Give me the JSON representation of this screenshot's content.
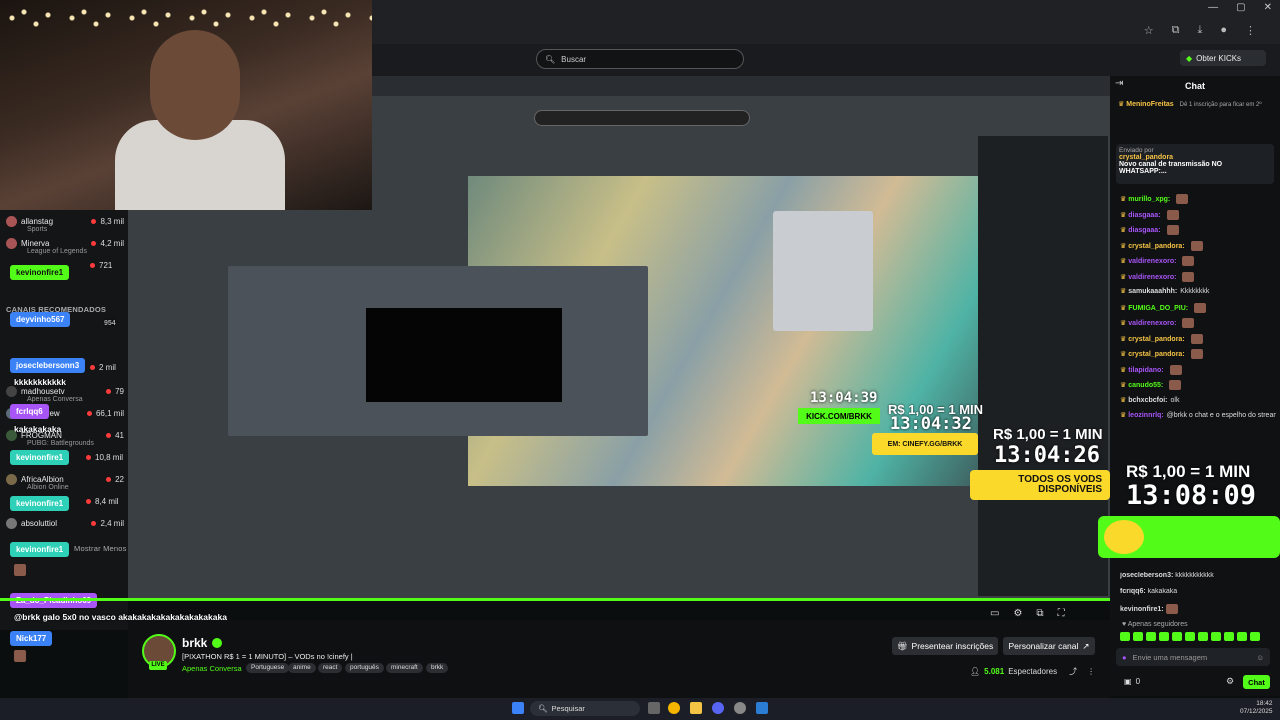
{
  "browser": {
    "window_controls": [
      "—",
      "▢",
      "✕"
    ]
  },
  "header": {
    "search_placeholder": "Buscar",
    "kicks_label": "Obter KICKs"
  },
  "sidebar": {
    "items": [
      {
        "name": "allanstag",
        "sub": "Sports",
        "count": "8,3 mil"
      },
      {
        "name": "Minerva",
        "sub": "League of Legends",
        "count": "4,2 mil"
      },
      {
        "name": "kevinonfire1",
        "sub": "",
        "count": "721"
      },
      {
        "name": "madhousetv",
        "sub": "",
        "count": "79"
      },
      {
        "name": "SalveDrew",
        "sub": "Apenas Conversa",
        "count": "66,1 mil"
      },
      {
        "name": "FROGMAN",
        "sub": "PUBG: Battlegrounds",
        "count": "41"
      },
      {
        "name": "AfricaAlbion",
        "sub": "Albion Online",
        "count": "10,8 mil"
      },
      {
        "name": "absoluttiol",
        "sub": "",
        "count": "2,4 mil"
      }
    ],
    "section_recommended": "CANAIS RECOMENDADOS",
    "show_less": "Mostrar Menos",
    "overlay_tags": [
      "kevinonfire1",
      "deyvinho567",
      "joseclebersonn3",
      "kkkkkkkkkkk",
      "fcrlqq6",
      "kakakakaka",
      "kevinonfire1",
      "kevinonfire1",
      "kevinonfire1"
    ],
    "overlay_counts": [
      "954",
      "2 mil",
      "8,4 mil",
      "22"
    ]
  },
  "stream": {
    "overlay_clock_small": "13:04:39",
    "overlay_clock_mid": "13:04:32",
    "overlay_rs_mid": "R$ 1,00 = 1 MIN",
    "overlay_rs_right": "R$ 1,00 = 1 MIN",
    "overlay_clock_right": "13:04:26",
    "overlay_promo": "TODOS OS VODS DISPONÍVEIS",
    "overlay_promo_small": "EM: CINEFY.GG/BRKK",
    "kick_tag": "KICK.COM/BRKK"
  },
  "overlay_chat": [
    {
      "user": "Za_do_Picadinho69",
      "text": ""
    },
    {
      "user": "@brkk galo 5x0 no vasco akakakakakakakakakakaka",
      "text": ""
    },
    {
      "user": "Nick177",
      "text": ""
    }
  ],
  "channel": {
    "name": "brkk",
    "live": "LIVE",
    "title": "[PIXATHON R$ 1 = 1 MINUTO] – VODs no !cinefy |",
    "category": "Apenas Conversa",
    "tags": [
      "Portuguese",
      "anime",
      "react",
      "português",
      "minecraft",
      "brkk"
    ],
    "btn_subs": "Presentear inscrições",
    "btn_custom": "Personalizar canal",
    "viewers_count": "5.081",
    "viewers_label": "Espectadores"
  },
  "chat": {
    "title": "Chat",
    "pinned_user": "MeninoFreitas",
    "pinned_text": "Dê 1 inscrição para ficar em 2º",
    "sent_by": "Enviado por",
    "sent_user": "crystal_pandora",
    "sent_text": "Novo canal de transmissão NO WHATSAPP:...",
    "messages": [
      {
        "user": "murillo_xpg:",
        "color": "#53fc18",
        "text": ""
      },
      {
        "user": "diasgaaa:",
        "color": "#a855f7",
        "text": ""
      },
      {
        "user": "diasgaaa:",
        "color": "#a855f7",
        "text": ""
      },
      {
        "user": "crystal_pandora:",
        "color": "#f6c445",
        "text": ""
      },
      {
        "user": "valdirenexoro:",
        "color": "#a855f7",
        "text": ""
      },
      {
        "user": "valdirenexoro:",
        "color": "#a855f7",
        "text": ""
      },
      {
        "user": "samukaaahhh:",
        "color": "#ddd",
        "text": "Kkkkkkkk"
      },
      {
        "user": "FUMIGA_DO_PIU:",
        "color": "#53fc18",
        "text": ""
      },
      {
        "user": "valdirenexoro:",
        "color": "#a855f7",
        "text": ""
      },
      {
        "user": "crystal_pandora:",
        "color": "#f6c445",
        "text": ""
      },
      {
        "user": "crystal_pandora:",
        "color": "#f6c445",
        "text": ""
      },
      {
        "user": "tilapidano:",
        "color": "#a855f7",
        "text": ""
      },
      {
        "user": "canudo55:",
        "color": "#53fc18",
        "text": ""
      },
      {
        "user": "bchxcbcfoi:",
        "color": "#ddd",
        "text": "olk"
      },
      {
        "user": "leozinnrlq:",
        "color": "#a855f7",
        "text": "@brkk o chat e o espelho do streamer"
      }
    ],
    "overlay_rs": "R$ 1,00 = 1 MIN",
    "overlay_clock": "13:08:09",
    "bottom_messages": [
      {
        "user": "josecleberson3:",
        "color": "#ddd",
        "text": "kkkkkkkkkkk"
      },
      {
        "user": "fcriqq6:",
        "color": "#ddd",
        "text": "kakakaka"
      },
      {
        "user": "kevinonfire1:",
        "color": "#ddd",
        "text": ""
      }
    ],
    "followers_only": "Apenas seguidores",
    "input_placeholder": "Envie uma mensagem",
    "kicks_count": "0",
    "send_label": "Chat"
  },
  "taskbar": {
    "search_label": "Pesquisar",
    "time": "18:42",
    "date": "07/12/2025"
  },
  "colors": {
    "kick_green": "#53fc18",
    "bg_dark": "#0b0e0f"
  }
}
